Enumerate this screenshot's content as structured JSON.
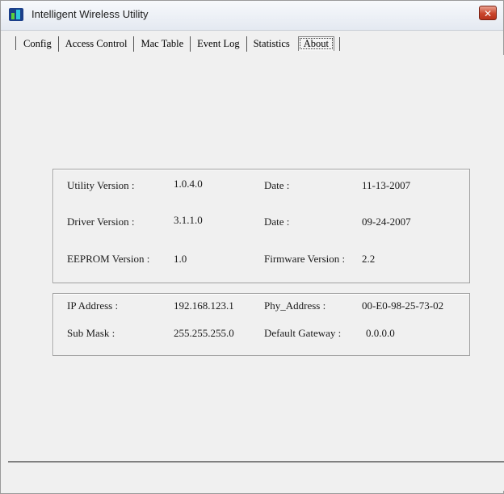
{
  "window": {
    "title": "Intelligent Wireless Utility",
    "close_glyph": "✕"
  },
  "tabs": [
    {
      "label": "Config"
    },
    {
      "label": "Access Control"
    },
    {
      "label": "Mac Table"
    },
    {
      "label": "Event Log"
    },
    {
      "label": "Statistics"
    },
    {
      "label": "About",
      "active": true
    }
  ],
  "about": {
    "version_info": {
      "utility_version_label": "Utility Version :",
      "utility_version_value": "1.0.4.0",
      "utility_date_label": "Date :",
      "utility_date_value": "11-13-2007",
      "driver_version_label": "Driver Version :",
      "driver_version_value": "3.1.1.0",
      "driver_date_label": "Date :",
      "driver_date_value": "09-24-2007",
      "eeprom_version_label": "EEPROM Version :",
      "eeprom_version_value": "1.0",
      "firmware_version_label": "Firmware Version :",
      "firmware_version_value": "2.2"
    },
    "network_info": {
      "ip_address_label": "IP Address :",
      "ip_address_value": "192.168.123.1",
      "phy_address_label": "Phy_Address :",
      "phy_address_value": "00-E0-98-25-73-02",
      "sub_mask_label": "Sub Mask :",
      "sub_mask_value": "255.255.255.0",
      "default_gateway_label": "Default Gateway :",
      "default_gateway_value": "0.0.0.0"
    }
  },
  "colors": {
    "close_button": "#c9452c",
    "panel_background": "#f0f0f0"
  }
}
